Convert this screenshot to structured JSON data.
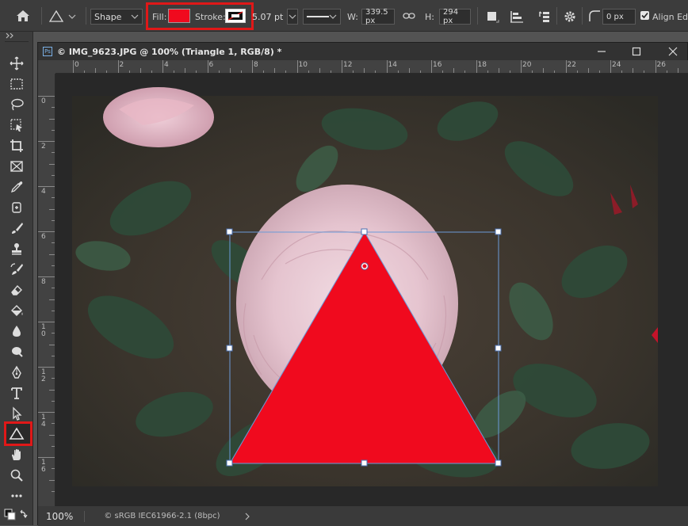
{
  "options_bar": {
    "shape_mode": "Shape",
    "fill_label": "Fill:",
    "fill_color": "#f00a1e",
    "stroke_label": "Stroke:",
    "stroke_width": "5.07 pt",
    "w_label": "W:",
    "w_value": "339.5 px",
    "h_label": "H:",
    "h_value": "294 px",
    "radius_value": "0 px",
    "align_edges_label": "Align Edges"
  },
  "document": {
    "tab_title": "© IMG_9623.JPG @ 100% (Triangle 1, RGB/8) *",
    "ps_badge": "Ps",
    "ruler_top_labels": [
      "0",
      "2",
      "4",
      "6",
      "8",
      "10",
      "12",
      "14",
      "16",
      "18",
      "20",
      "22",
      "24",
      "26"
    ],
    "ruler_left_labels": [
      "0",
      "2",
      "4",
      "6",
      "8",
      "1 0",
      "1 2",
      "1 4",
      "1 6"
    ],
    "triangle_color": "#f00a1e"
  },
  "status": {
    "zoom": "100%",
    "profile": "© sRGB IEC61966-2.1 (8bpc)"
  },
  "tools": [
    "move-tool",
    "marquee-tool",
    "lasso-tool",
    "object-select-tool",
    "crop-tool",
    "frame-tool",
    "eyedropper-tool",
    "healing-tool",
    "brush-tool",
    "stamp-tool",
    "history-brush-tool",
    "eraser-tool",
    "paint-bucket-tool",
    "blur-tool",
    "dodge-tool",
    "pen-tool",
    "type-tool",
    "path-select-tool",
    "triangle-tool",
    "hand-tool",
    "zoom-tool",
    "more-tools"
  ]
}
